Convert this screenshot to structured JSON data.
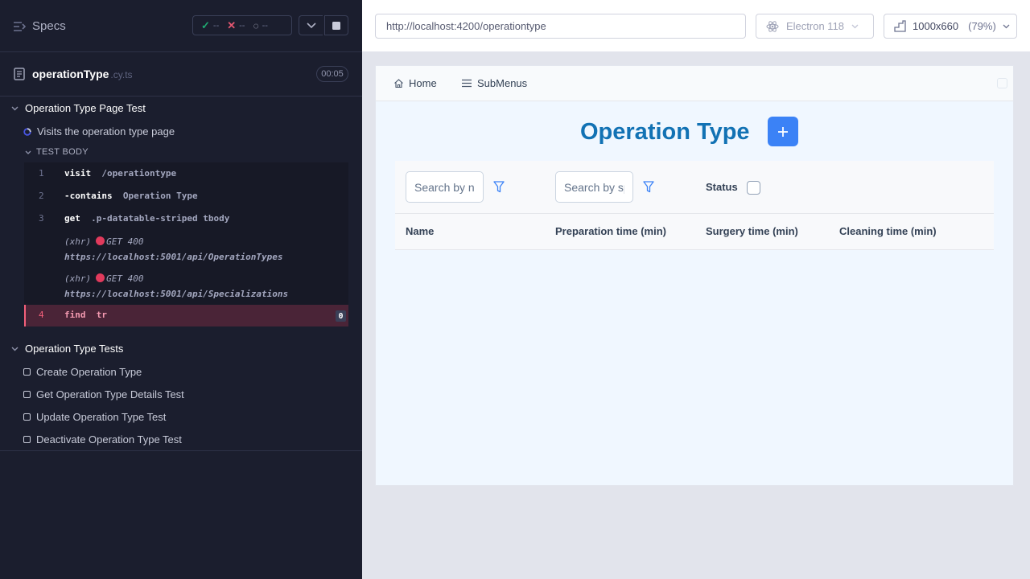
{
  "reporter": {
    "specs_label": "Specs",
    "stats": {
      "passed": "--",
      "failed": "--",
      "pending": "--"
    },
    "spec_file": {
      "name": "operationType",
      "ext": ".cy.ts",
      "duration": "00:05"
    },
    "suite1": {
      "title": "Operation Type Page Test",
      "test": "Visits the operation type page",
      "test_body": "TEST BODY",
      "commands": [
        {
          "num": "1",
          "name": "visit",
          "message": "/operationtype"
        },
        {
          "num": "2",
          "name": "-contains",
          "message": "Operation Type"
        },
        {
          "num": "3",
          "name": "get",
          "message": ".p-datatable-striped tbody"
        }
      ],
      "xhr": [
        {
          "label": "(xhr)",
          "method": "GET",
          "status": "400",
          "url": "https://localhost:5001/api/OperationTypes"
        },
        {
          "label": "(xhr)",
          "method": "GET",
          "status": "400",
          "url": "https://localhost:5001/api/Specializations"
        }
      ],
      "failed_command": {
        "num": "4",
        "name": "find",
        "message": "tr",
        "badge": "0"
      }
    },
    "suite2": {
      "title": "Operation Type Tests",
      "tests": [
        "Create Operation Type",
        "Get Operation Type Details Test",
        "Update Operation Type Test",
        "Deactivate Operation Type Test"
      ]
    }
  },
  "aut": {
    "url": "http://localhost:4200/operationtype",
    "browser": "Electron 118",
    "viewport": "1000x660",
    "scale": "(79%)"
  },
  "app": {
    "nav": {
      "home": "Home",
      "submenus": "SubMenus"
    },
    "title": "Operation Type",
    "filters": {
      "name_placeholder": "Search by name",
      "spec_placeholder": "Search by specialization",
      "status_label": "Status"
    },
    "columns": [
      "Name",
      "Preparation time (min)",
      "Surgery time (min)",
      "Cleaning time (min)"
    ]
  },
  "colors": {
    "accent": "#3b82f6",
    "title": "#1272b4",
    "fail": "#e13a5c",
    "pass": "#1fa971"
  }
}
